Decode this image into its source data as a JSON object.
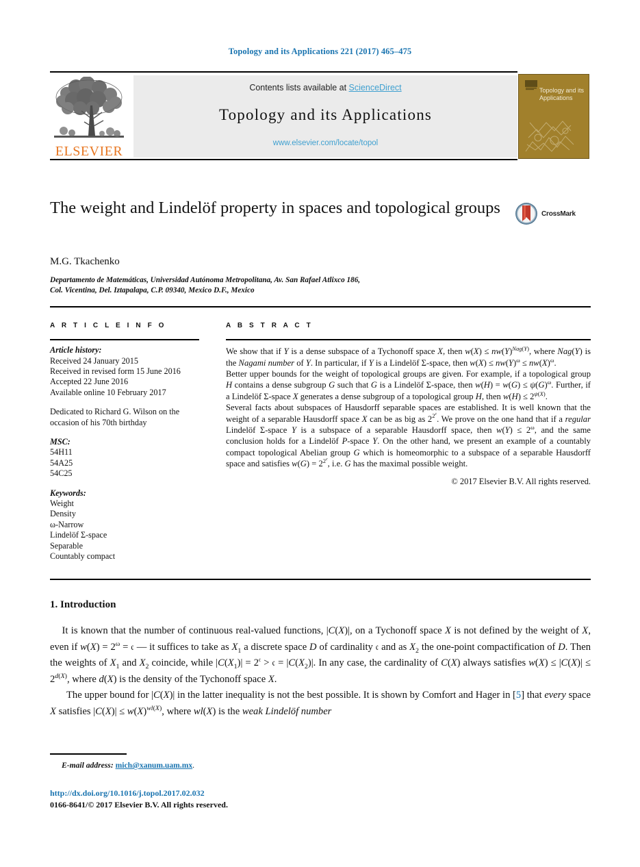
{
  "running_head": "Topology and its Applications 221 (2017) 465–475",
  "masthead": {
    "contents_prefix": "Contents lists available at ",
    "sciencedirect_link": "ScienceDirect",
    "journal_name": "Topology and its Applications",
    "journal_url": "www.elsevier.com/locate/topol",
    "publisher_logo_text": "ELSEVIER",
    "cover_title": "Topology and its Applications"
  },
  "article": {
    "title": "The weight and Lindelöf property in spaces and topological groups",
    "author": "M.G. Tkachenko",
    "affiliation_line1": "Departamento de Matemáticas, Universidad Autónoma Metropolitana, Av. San Rafael Atlixco 186,",
    "affiliation_line2": "Col. Vicentina, Del. Iztapalapa, C.P. 09340, Mexico D.F., Mexico",
    "crossmark_label": "CrossMark"
  },
  "info": {
    "heading": "A R T I C L E   I N F O",
    "history_label": "Article history:",
    "history": [
      "Received 24 January 2015",
      "Received in revised form 15 June 2016",
      "Accepted 22 June 2016",
      "Available online 10 February 2017"
    ],
    "dedication": "Dedicated to Richard G. Wilson on the occasion of his 70th birthday",
    "msc_label": "MSC:",
    "msc": [
      "54H11",
      "54A25",
      "54C25"
    ],
    "keywords_label": "Keywords:",
    "keywords": [
      "Weight",
      "Density",
      "ω-Narrow",
      "Lindelöf Σ-space",
      "Separable",
      "Countably compact"
    ]
  },
  "abstract": {
    "heading": "A B S T R A C T",
    "paragraphs": [
      "We show that if Y is a dense subspace of a Tychonoff space X, then w(X) ≤ nw(Y)^Nag(Y), where Nag(Y) is the Nagami number of Y. In particular, if Y is a Lindelöf Σ-space, then w(X) ≤ nw(Y)^ω ≤ nw(X)^ω.",
      "Better upper bounds for the weight of topological groups are given. For example, if a topological group H contains a dense subgroup G such that G is a Lindelöf Σ-space, then w(H) = w(G) ≤ ψ(G)^ω. Further, if a Lindelöf Σ-space X generates a dense subgroup of a topological group H, then w(H) ≤ 2^ψ(X).",
      "Several facts about subspaces of Hausdorff separable spaces are established. It is well known that the weight of a separable Hausdorff space X can be as big as 2^2^c. We prove on the one hand that if a regular Lindelöf Σ-space Y is a subspace of a separable Hausdorff space, then w(Y) ≤ 2^ω, and the same conclusion holds for a Lindelöf P-space Y. On the other hand, we present an example of a countably compact topological Abelian group G which is homeomorphic to a subspace of a separable Hausdorff space and satisfies w(G) = 2^2^c, i.e. G has the maximal possible weight."
    ],
    "copyright": "© 2017 Elsevier B.V. All rights reserved."
  },
  "body": {
    "section_title": "1.  Introduction",
    "paragraph1": "It is known that the number of continuous real-valued functions, |C(X)|, on a Tychonoff space X is not defined by the weight of X, even if w(X) = 2^ω = c — it suffices to take as X₁ a discrete space D of cardinality c and as X₂ the one-point compactification of D. Then the weights of X₁ and X₂ coincide, while |C(X₁)| = 2^c > c = |C(X₂)|. In any case, the cardinality of C(X) always satisfies w(X) ≤ |C(X)| ≤ 2^d(X), where d(X) is the density of the Tychonoff space X.",
    "paragraph2": "The upper bound for |C(X)| in the latter inequality is not the best possible. It is shown by Comfort and Hager in [5] that every space X satisfies |C(X)| ≤ w(X)^wl(X), where wl(X) is the weak Lindelöf number",
    "reference_number": "5"
  },
  "footer": {
    "email_label": "E-mail address:",
    "email": "mich@xanum.uam.mx",
    "doi": "http://dx.doi.org/10.1016/j.topol.2017.02.032",
    "issn_line": "0166-8641/© 2017 Elsevier B.V. All rights reserved."
  },
  "colors": {
    "link_blue": "#1a74b0",
    "sciencedirect_blue": "#3fa0d0",
    "elsevier_orange": "#E87722",
    "cover_gold": "#a1802c"
  }
}
